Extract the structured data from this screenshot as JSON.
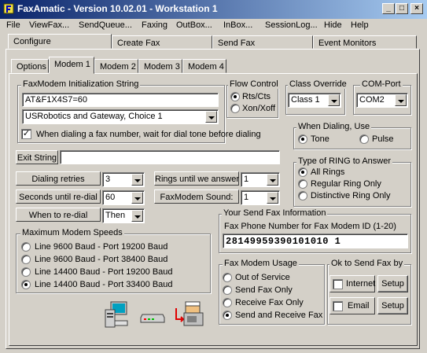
{
  "window": {
    "title": "FaxAmatic - Version 10.02.01 - Workstation 1",
    "controls": [
      "_",
      "□",
      "×"
    ]
  },
  "menu": [
    "File",
    "ViewFax...",
    "SendQueue...",
    "Faxing",
    "OutBox...",
    "InBox...",
    "SessionLog...",
    "Hide",
    "Help"
  ],
  "main_tabs": [
    "Configure",
    "Create Fax",
    "Send Fax",
    "Event Monitors"
  ],
  "sub_tabs": [
    "Options",
    "Modem 1",
    "Modem 2",
    "Modem 3",
    "Modem 4"
  ],
  "init": {
    "group": "FaxModem Initialization String",
    "string_value": "AT&F1X4S7=60",
    "modem_select": "USRobotics and Gateway, Choice 1",
    "wait_dialtone_label": "When dialing a fax number, wait for dial tone before dialing",
    "wait_dialtone_checked": true
  },
  "flow": {
    "group": "Flow Control",
    "options": [
      "Rts/Cts",
      "Xon/Xoff"
    ],
    "selected": 0
  },
  "class_override": {
    "group": "Class Override",
    "value": "Class 1"
  },
  "com_port": {
    "group": "COM-Port",
    "value": "COM2"
  },
  "when_dialing": {
    "group": "When Dialing, Use",
    "options": [
      "Tone",
      "Pulse"
    ],
    "selected": 0
  },
  "exit_string": {
    "label": "Exit String",
    "value": ""
  },
  "dial": {
    "retries_label": "Dialing retries",
    "retries_value": "3",
    "seconds_label": "Seconds until re-dial",
    "seconds_value": "60",
    "when_label": "When to re-dial",
    "when_value": "Then",
    "rings_label": "Rings until we answer",
    "rings_value": "1",
    "sound_label": "FaxModem Sound:",
    "sound_value": "1"
  },
  "ring_type": {
    "group": "Type of RING to Answer",
    "options": [
      "All Rings",
      "Regular Ring Only",
      "Distinctive Ring Only"
    ],
    "selected": 0
  },
  "speeds": {
    "group": "Maximum Modem Speeds",
    "options": [
      "Line 9600 Baud - Port 19200 Baud",
      "Line 9600 Baud - Port 38400 Baud",
      "Line 14400 Baud - Port 19200 Baud",
      "Line 14400 Baud - Port 33400 Baud"
    ],
    "selected": 3
  },
  "send_info": {
    "group": "Your Send Fax Information",
    "label": "Fax Phone Number for Fax Modem ID (1-20)",
    "value": "28149959390101010 1"
  },
  "usage": {
    "group": "Fax Modem Usage",
    "options": [
      "Out of Service",
      "Send Fax Only",
      "Receive Fax Only",
      "Send and Receive Fax"
    ],
    "selected": 3
  },
  "ok_send": {
    "group": "Ok to Send Fax by",
    "internet_label": "Internet",
    "email_label": "Email",
    "setup_label": "Setup"
  }
}
